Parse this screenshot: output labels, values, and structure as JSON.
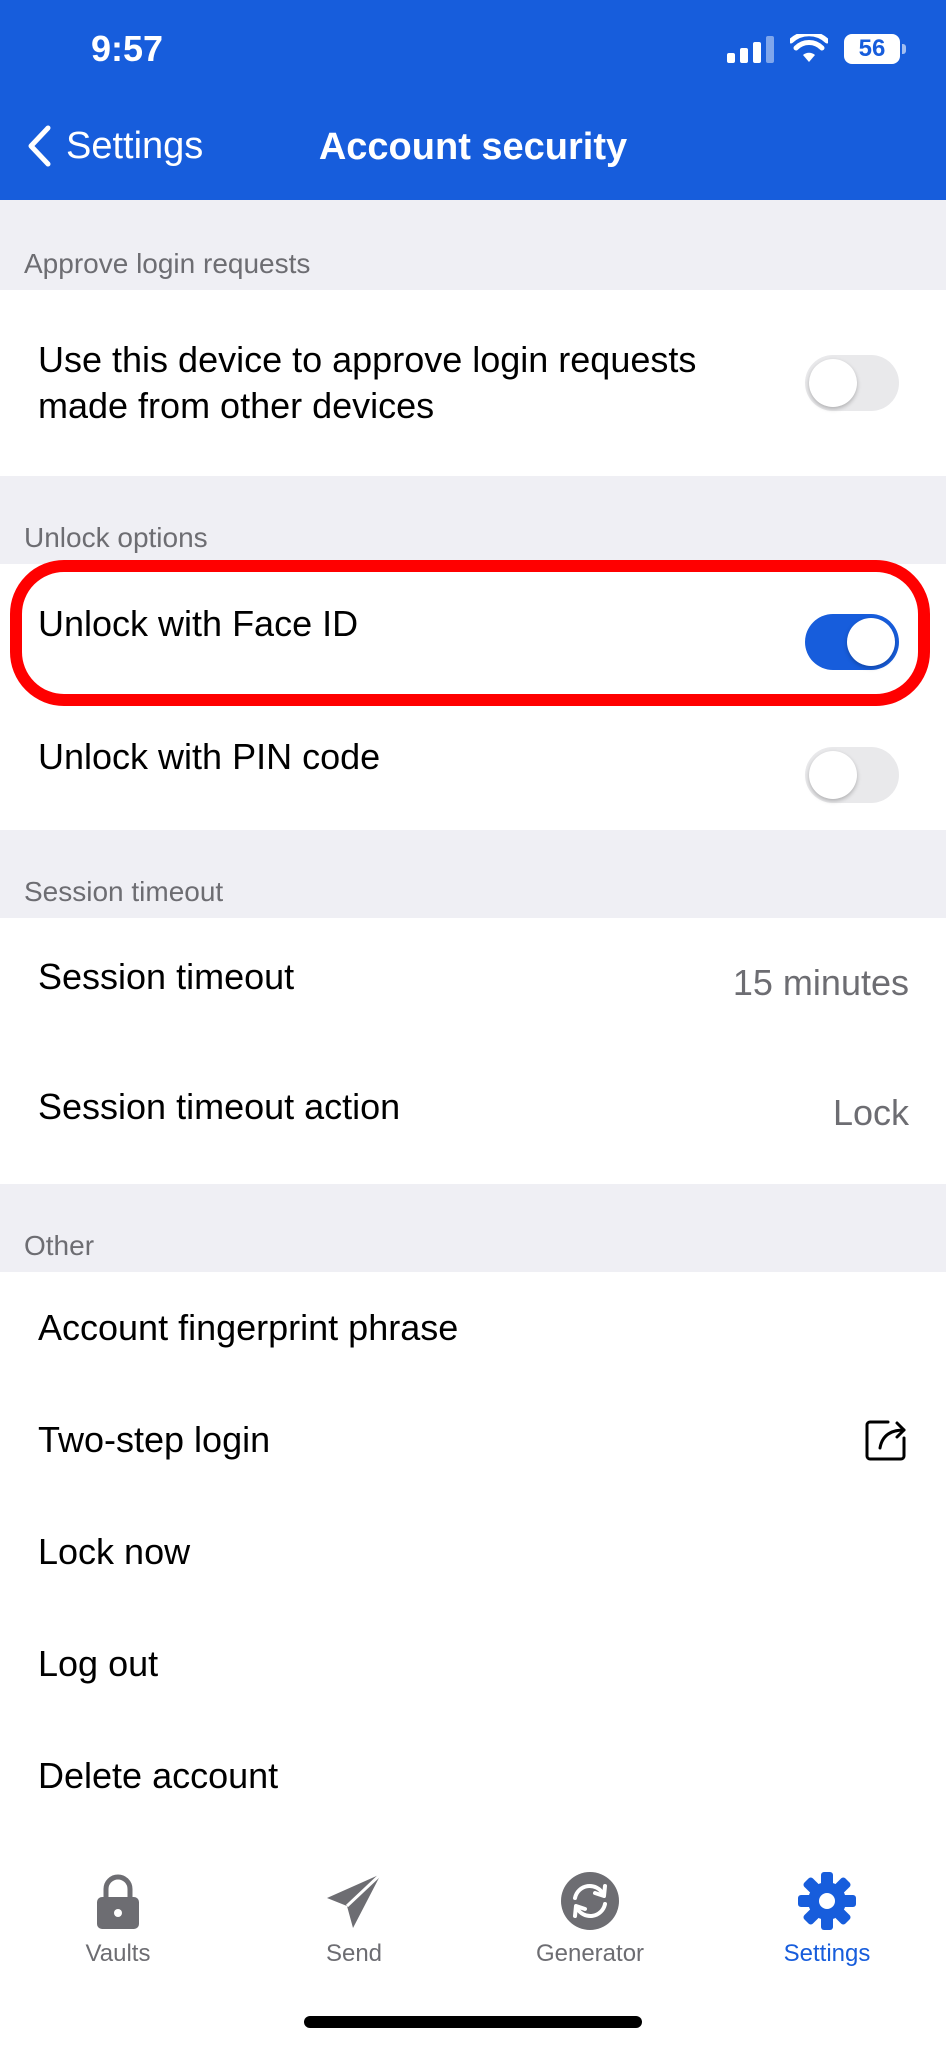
{
  "status_bar": {
    "time": "9:57",
    "battery": "56"
  },
  "nav": {
    "back_label": "Settings",
    "title": "Account security"
  },
  "sections": {
    "approve": {
      "header": "Approve login requests",
      "items": [
        {
          "label": "Use this device to approve login requests made from other devices",
          "toggle": false
        }
      ]
    },
    "unlock": {
      "header": "Unlock options",
      "items": [
        {
          "label": "Unlock with Face ID",
          "toggle": true
        },
        {
          "label": "Unlock with PIN code",
          "toggle": false
        }
      ]
    },
    "session": {
      "header": "Session timeout",
      "items": [
        {
          "label": "Session timeout",
          "value": "15 minutes"
        },
        {
          "label": "Session timeout action",
          "value": "Lock"
        }
      ]
    },
    "other": {
      "header": "Other",
      "items": [
        {
          "label": "Account fingerprint phrase"
        },
        {
          "label": "Two-step login",
          "icon": "external-link-icon"
        },
        {
          "label": "Lock now"
        },
        {
          "label": "Log out"
        },
        {
          "label": "Delete account"
        }
      ]
    }
  },
  "tabbar": {
    "items": [
      {
        "label": "Vaults",
        "icon": "lock-icon",
        "active": false
      },
      {
        "label": "Send",
        "icon": "paper-plane-icon",
        "active": false
      },
      {
        "label": "Generator",
        "icon": "refresh-icon",
        "active": false
      },
      {
        "label": "Settings",
        "icon": "gear-icon",
        "active": true
      }
    ]
  },
  "colors": {
    "brand": "#175ddc",
    "highlight": "#ff0000",
    "background": "#efeff4"
  }
}
